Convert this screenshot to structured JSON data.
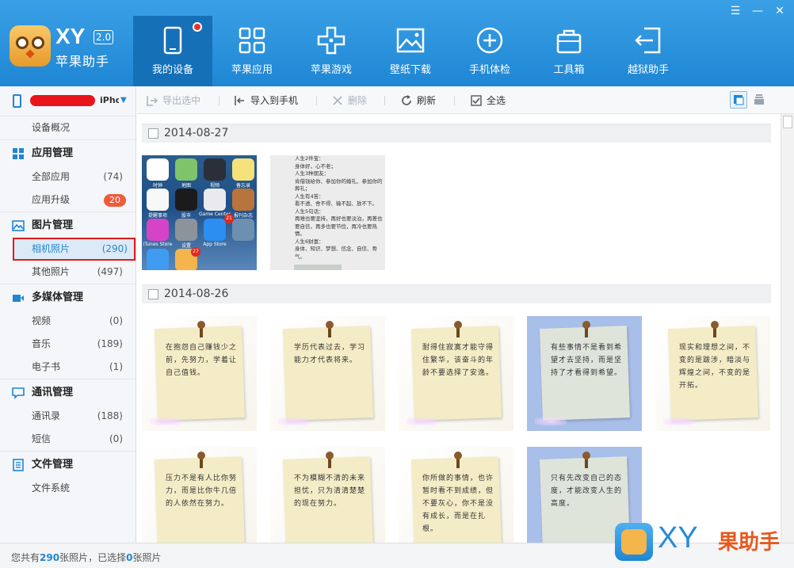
{
  "app": {
    "brand": "XY",
    "version": "2.0",
    "subtitle": "苹果助手"
  },
  "nav": [
    {
      "label": "我的设备",
      "icon": "tablet-icon",
      "active": true,
      "dot": true
    },
    {
      "label": "苹果应用",
      "icon": "apps-grid-icon"
    },
    {
      "label": "苹果游戏",
      "icon": "gamepad-icon"
    },
    {
      "label": "壁纸下载",
      "icon": "image-icon"
    },
    {
      "label": "手机体检",
      "icon": "plus-circle-icon"
    },
    {
      "label": "工具箱",
      "icon": "briefcase-icon"
    },
    {
      "label": "越狱助手",
      "icon": "exit-arrow-icon"
    }
  ],
  "sidebar": {
    "device_name": "iPho...",
    "overview": "设备概况",
    "app_mgmt": {
      "title": "应用管理",
      "all_apps": "全部应用",
      "all_apps_count": "(74)",
      "upgrade": "应用升级",
      "upgrade_badge": "20"
    },
    "photo_mgmt": {
      "title": "图片管理",
      "camera": "相机照片",
      "camera_count": "(290)",
      "other": "其他照片",
      "other_count": "(497)"
    },
    "media_mgmt": {
      "title": "多媒体管理",
      "video": "视频",
      "video_count": "(0)",
      "music": "音乐",
      "music_count": "(189)",
      "ebook": "电子书",
      "ebook_count": "(1)"
    },
    "comm_mgmt": {
      "title": "通讯管理",
      "contacts": "通讯录",
      "contacts_count": "(188)",
      "sms": "短信",
      "sms_count": "(0)"
    },
    "file_mgmt": {
      "title": "文件管理",
      "filesystem": "文件系统"
    }
  },
  "toolbar": {
    "export": "导出选中",
    "import": "导入到手机",
    "delete": "删除",
    "refresh": "刷新",
    "select_all": "全选"
  },
  "groups": [
    {
      "date": "2014-08-27"
    },
    {
      "date": "2014-08-26"
    }
  ],
  "ios_apps": [
    {
      "name": "时钟",
      "color": "#ffffff"
    },
    {
      "name": "地图",
      "color": "#7fc46b"
    },
    {
      "name": "视频",
      "color": "#2a2f3a"
    },
    {
      "name": "备忘录",
      "color": "#f6e27a"
    },
    {
      "name": "提醒事项",
      "color": "#f8f8f8"
    },
    {
      "name": "股市",
      "color": "#1b1b1b"
    },
    {
      "name": "Game Center",
      "color": "#e9e9ef"
    },
    {
      "name": "报刊杂志",
      "color": "#b8743c"
    },
    {
      "name": "iTunes Store",
      "color": "#d544c8"
    },
    {
      "name": "设置",
      "color": "#8c939b"
    },
    {
      "name": "App Store",
      "color": "#2b8ef0"
    },
    {
      "name": "",
      "color": "#6d8fb0"
    },
    {
      "name": "Safari",
      "color": "#3f9cf0"
    },
    {
      "name": "",
      "color": "#f3b54c"
    }
  ],
  "ios_badges": [
    "21",
    "27"
  ],
  "text_note": "人生2件宝：\n身体好，心不老；\n人生3种朋友：\n肯借钱给你、参加你的婚礼、参加你的葬礼；\n人生有4苦：\n看不透、舍不得、输不起、放不下。\n人生5句话：\n再难也要坚持，再好也要淡泊，再差也要自信，再多也要节俭，再冷也要热情。\n人生6财富：\n身体、知识、梦想、信念、自信、骨气。",
  "notes_row1": [
    {
      "text": "在抱怨自己赚钱少之前，先努力，学着让自己值钱。",
      "selected": false
    },
    {
      "text": "学历代表过去，学习能力才代表将来。",
      "selected": false
    },
    {
      "text": "耐得住寂寞才能守得住繁华，该奋斗的年龄不要选择了安逸。",
      "selected": false
    },
    {
      "text": "有些事情不是看到希望才去坚持，而是坚持了才看得到希望。",
      "selected": true
    },
    {
      "text": "现实和理想之间，不变的是跋涉，暗淡与辉煌之间，不变的是开拓。",
      "selected": false
    }
  ],
  "notes_row2": [
    {
      "text": "压力不是有人比你努力，而是比你牛几倍的人依然在努力。",
      "selected": false
    },
    {
      "text": "不为模糊不清的未来担忧，只为清清楚楚的现在努力。",
      "selected": false
    },
    {
      "text": "你所做的事情，也许暂时看不到成绩，但不要灰心，你不是没有成长，而是在扎根。",
      "selected": false
    },
    {
      "text": "只有先改变自己的态度，才能改变人生的高度。",
      "selected": true
    }
  ],
  "status": {
    "prefix": "您共有",
    "total": "290",
    "mid": "张照片，已选择",
    "selected": "0",
    "suffix": "张照片"
  },
  "watermark": {
    "text": "XY",
    "text2": "果助手"
  }
}
